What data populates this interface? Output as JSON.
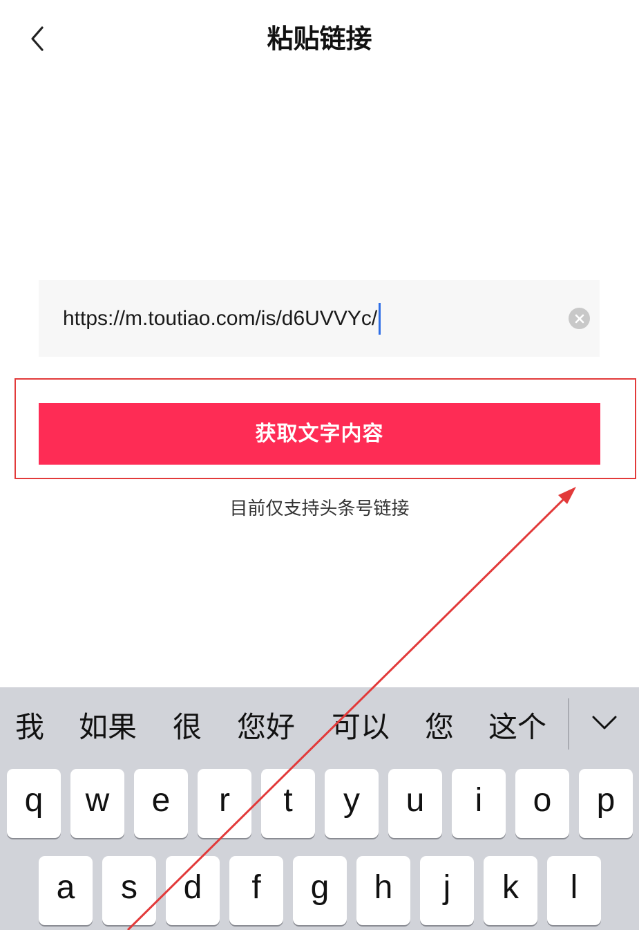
{
  "header": {
    "title": "粘贴链接"
  },
  "url_input": {
    "value": "https://m.toutiao.com/is/d6UVVYc/"
  },
  "submit_button": {
    "label": "获取文字内容"
  },
  "hint": "目前仅支持头条号链接",
  "keyboard": {
    "candidates": [
      "我",
      "如果",
      "很",
      "您好",
      "可以",
      "您",
      "这个"
    ],
    "row1": [
      "q",
      "w",
      "e",
      "r",
      "t",
      "y",
      "u",
      "i",
      "o",
      "p"
    ],
    "row2": [
      "a",
      "s",
      "d",
      "f",
      "g",
      "h",
      "j",
      "k",
      "l"
    ]
  },
  "colors": {
    "accent": "#fe2c55",
    "annotation": "#e23a3a",
    "caret": "#2e6ee6",
    "keyboard_bg": "#d1d3d9"
  },
  "icons": {
    "back": "chevron-left-icon",
    "clear": "clear-circle-icon",
    "collapse": "chevron-down-icon"
  }
}
